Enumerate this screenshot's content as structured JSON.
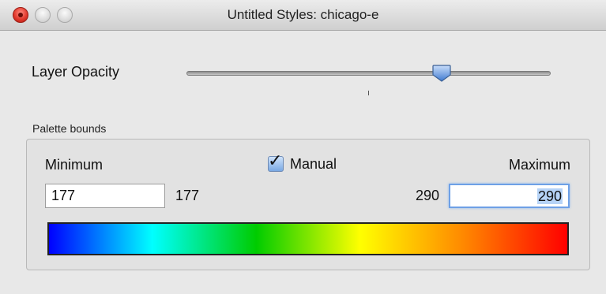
{
  "window": {
    "title": "Untitled Styles: chicago-e"
  },
  "opacity": {
    "label": "Layer Opacity",
    "value": 0.7
  },
  "palette_bounds": {
    "group_label": "Palette bounds",
    "minimum_label": "Minimum",
    "maximum_label": "Maximum",
    "manual_label": "Manual",
    "manual_checked": true,
    "min_input_value": "177",
    "min_display": "177",
    "max_display": "290",
    "max_input_value": "290",
    "colormap": [
      "#0000ff",
      "#00ffff",
      "#00cc00",
      "#ffff00",
      "#ff8800",
      "#ff0000"
    ]
  },
  "colors": {
    "close": "#e23a2e",
    "focus_ring": "#6ea0e6",
    "thumb": "#5b8fd8"
  },
  "icons": {
    "close": "close-button-icon",
    "minimize": "minimize-button-icon",
    "zoom": "zoom-button-icon",
    "check": "checkmark-icon"
  }
}
